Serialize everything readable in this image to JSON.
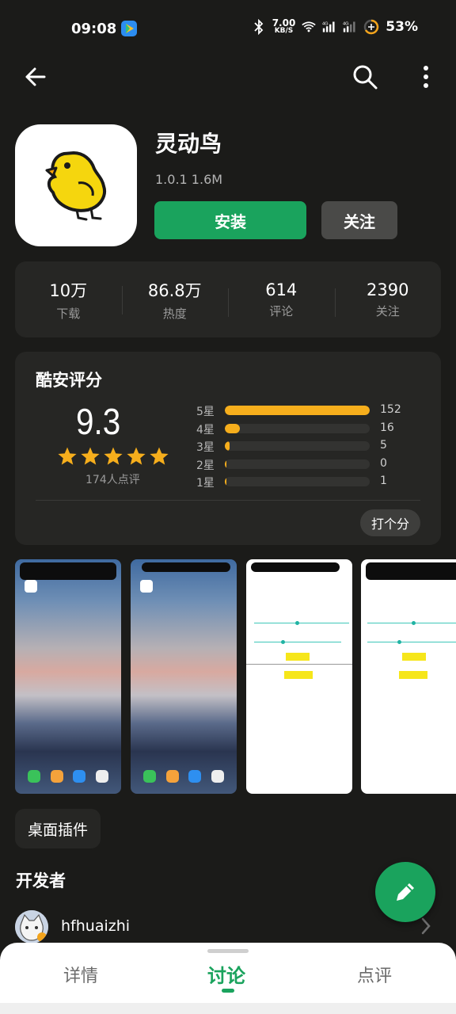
{
  "status_bar": {
    "time": "09:08",
    "net_speed_value": "7.00",
    "net_speed_unit": "KB/S",
    "battery": "53%"
  },
  "toolbar": {
    "back_icon": "arrow-left-icon",
    "search_icon": "search-icon",
    "more_icon": "more-vertical-icon"
  },
  "app": {
    "name": "灵动鸟",
    "meta": "1.0.1  1.6M",
    "install_label": "安装",
    "follow_label": "关注"
  },
  "stats": [
    {
      "value": "10万",
      "label": "下载"
    },
    {
      "value": "86.8万",
      "label": "热度"
    },
    {
      "value": "614",
      "label": "评论"
    },
    {
      "value": "2390",
      "label": "关注"
    }
  ],
  "rating": {
    "title": "酷安评分",
    "score": "9.3",
    "stars": 5,
    "raters": "174人点评",
    "rate_button": "打个分",
    "distribution": [
      {
        "label": "5星",
        "count": 152
      },
      {
        "label": "4星",
        "count": 16
      },
      {
        "label": "3星",
        "count": 5
      },
      {
        "label": "2星",
        "count": 0
      },
      {
        "label": "1星",
        "count": 1
      }
    ]
  },
  "colors": {
    "accent": "#1aa35d",
    "star": "#f6ae1c",
    "background": "#1b1b19",
    "card": "#262624"
  },
  "tags": [
    "桌面插件"
  ],
  "developer": {
    "section_title": "开发者",
    "name": "hfhuaizhi"
  },
  "bottom_nav": {
    "tabs": [
      "详情",
      "讨论",
      "点评"
    ],
    "active": 1
  }
}
